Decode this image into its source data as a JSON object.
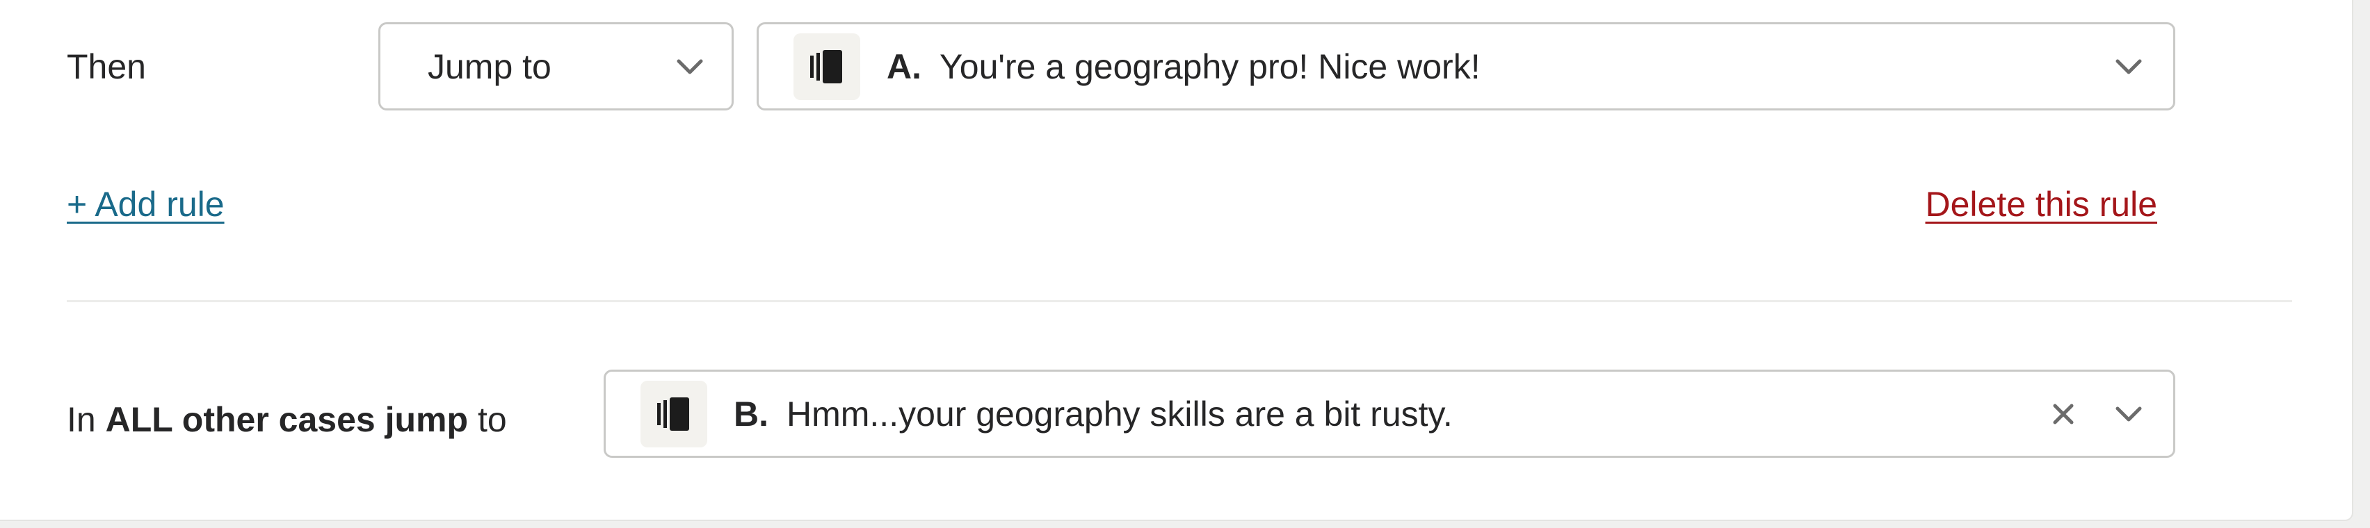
{
  "rule": {
    "then_label": "Then",
    "action": {
      "value": "Jump to",
      "icon": "chevron-down-icon"
    },
    "target": {
      "letter": "A.",
      "text": "You're a geography pro! Nice work!",
      "icon": "screen-icon"
    }
  },
  "links": {
    "add_rule": "+ Add rule",
    "delete_rule": "Delete this rule"
  },
  "fallback": {
    "label_prefix": "In",
    "label_bold": "ALL other cases jump",
    "label_suffix": "to",
    "target": {
      "letter": "B.",
      "text": "Hmm...your geography skills are a bit rusty.",
      "icon": "screen-icon"
    }
  },
  "colors": {
    "add_link": "#1a6a8a",
    "delete_link": "#a4161a",
    "border": "#c9c9c7",
    "icon_bg": "#f3f2ee"
  }
}
